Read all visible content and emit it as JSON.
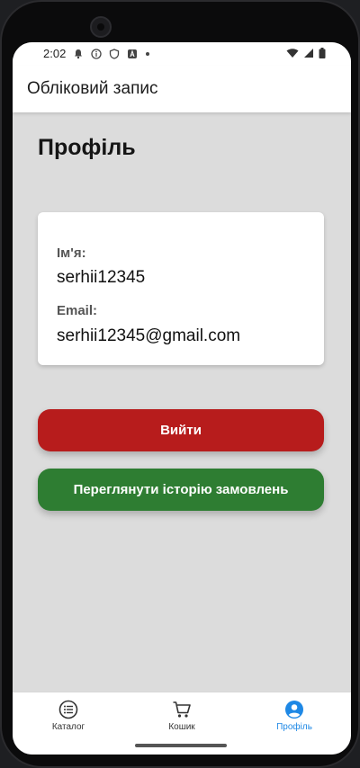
{
  "status_bar": {
    "time": "2:02"
  },
  "app_bar": {
    "title": "Обліковий запис"
  },
  "page": {
    "title": "Профіль"
  },
  "profile_card": {
    "name_label": "Ім'я:",
    "name_value": "serhii12345",
    "email_label": "Email:",
    "email_value": "serhii12345@gmail.com"
  },
  "buttons": {
    "logout": "Вийти",
    "history": "Переглянути історію замовлень"
  },
  "bottom_nav": {
    "items": [
      {
        "label": "Каталог",
        "icon": "list-icon",
        "active": false
      },
      {
        "label": "Кошик",
        "icon": "cart-icon",
        "active": false
      },
      {
        "label": "Профіль",
        "icon": "account-icon",
        "active": true
      }
    ]
  },
  "colors": {
    "logout": "#b71c1c",
    "history": "#2e7d32",
    "active_nav": "#1e88e5"
  }
}
